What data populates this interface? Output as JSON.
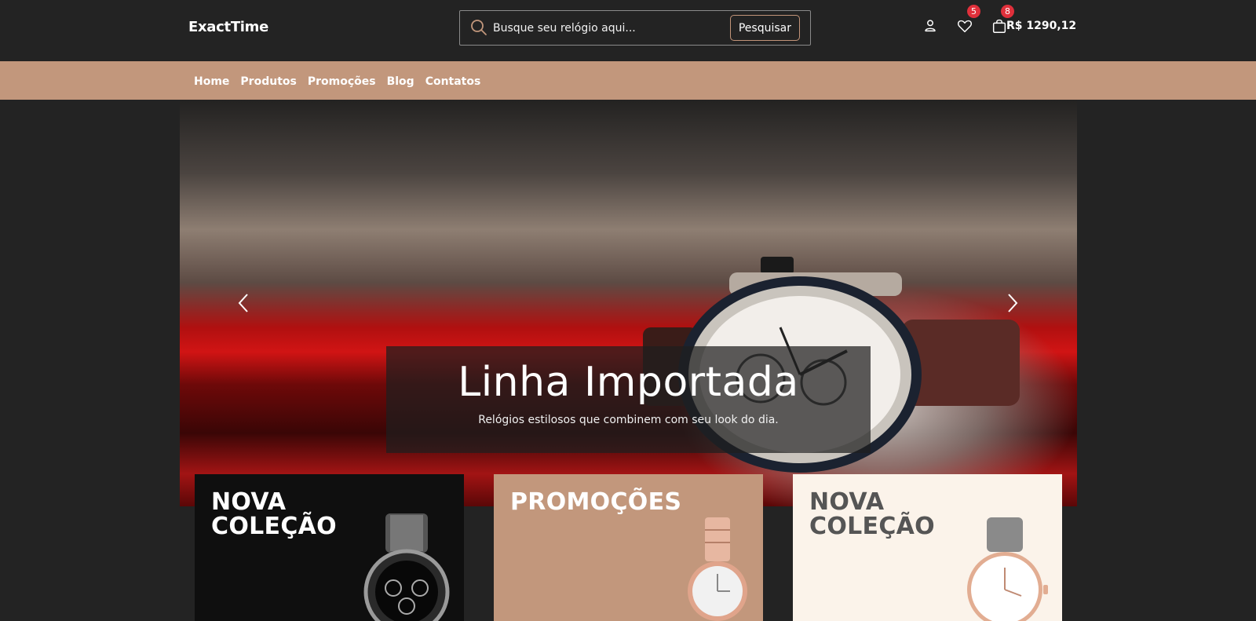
{
  "header": {
    "logo": "ExactTime",
    "search": {
      "placeholder": "Busque seu relógio aqui...",
      "button_label": "Pesquisar"
    },
    "wishlist_count": "5",
    "cart_count": "8",
    "cart_total": "R$ 1290,12",
    "icons": [
      "user-icon",
      "heart-icon",
      "shopping-bag-icon"
    ]
  },
  "nav": {
    "items": [
      {
        "label": "Home"
      },
      {
        "label": "Produtos"
      },
      {
        "label": "Promoções"
      },
      {
        "label": "Blog"
      },
      {
        "label": "Contatos"
      }
    ]
  },
  "hero": {
    "title": "Linha Importada",
    "subtitle": "Relógios estilosos que combinem com seu look do dia.",
    "prev_icon": "chevron-left-icon",
    "next_icon": "chevron-right-icon"
  },
  "cards": [
    {
      "line1": "NOVA",
      "line2": "COLEÇÃO",
      "bg": "#0f0f0f",
      "text_color": "#ffffff"
    },
    {
      "line1": "PROMOÇÕES",
      "line2": "",
      "bg": "#c2977c",
      "text_color": "#ffffff"
    },
    {
      "line1": "NOVA",
      "line2": "COLEÇÃO",
      "bg": "#fbf3ea",
      "text_color": "#555555"
    }
  ],
  "colors": {
    "accent": "#c2977c",
    "background": "#232323",
    "badge": "#e0303b"
  }
}
